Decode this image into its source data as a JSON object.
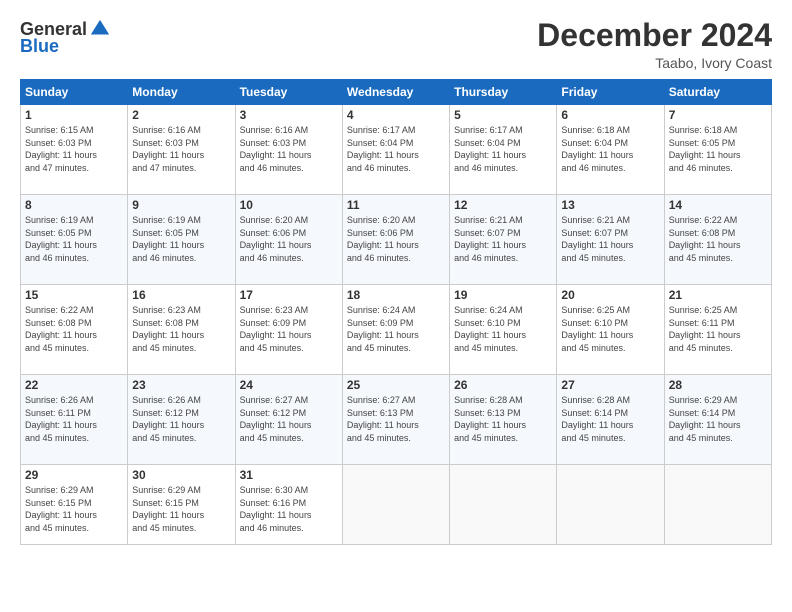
{
  "logo": {
    "general": "General",
    "blue": "Blue"
  },
  "header": {
    "title": "December 2024",
    "subtitle": "Taabo, Ivory Coast"
  },
  "weekdays": [
    "Sunday",
    "Monday",
    "Tuesday",
    "Wednesday",
    "Thursday",
    "Friday",
    "Saturday"
  ],
  "weeks": [
    [
      {
        "day": "1",
        "detail": "Sunrise: 6:15 AM\nSunset: 6:03 PM\nDaylight: 11 hours\nand 47 minutes."
      },
      {
        "day": "2",
        "detail": "Sunrise: 6:16 AM\nSunset: 6:03 PM\nDaylight: 11 hours\nand 47 minutes."
      },
      {
        "day": "3",
        "detail": "Sunrise: 6:16 AM\nSunset: 6:03 PM\nDaylight: 11 hours\nand 46 minutes."
      },
      {
        "day": "4",
        "detail": "Sunrise: 6:17 AM\nSunset: 6:04 PM\nDaylight: 11 hours\nand 46 minutes."
      },
      {
        "day": "5",
        "detail": "Sunrise: 6:17 AM\nSunset: 6:04 PM\nDaylight: 11 hours\nand 46 minutes."
      },
      {
        "day": "6",
        "detail": "Sunrise: 6:18 AM\nSunset: 6:04 PM\nDaylight: 11 hours\nand 46 minutes."
      },
      {
        "day": "7",
        "detail": "Sunrise: 6:18 AM\nSunset: 6:05 PM\nDaylight: 11 hours\nand 46 minutes."
      }
    ],
    [
      {
        "day": "8",
        "detail": "Sunrise: 6:19 AM\nSunset: 6:05 PM\nDaylight: 11 hours\nand 46 minutes."
      },
      {
        "day": "9",
        "detail": "Sunrise: 6:19 AM\nSunset: 6:05 PM\nDaylight: 11 hours\nand 46 minutes."
      },
      {
        "day": "10",
        "detail": "Sunrise: 6:20 AM\nSunset: 6:06 PM\nDaylight: 11 hours\nand 46 minutes."
      },
      {
        "day": "11",
        "detail": "Sunrise: 6:20 AM\nSunset: 6:06 PM\nDaylight: 11 hours\nand 46 minutes."
      },
      {
        "day": "12",
        "detail": "Sunrise: 6:21 AM\nSunset: 6:07 PM\nDaylight: 11 hours\nand 46 minutes."
      },
      {
        "day": "13",
        "detail": "Sunrise: 6:21 AM\nSunset: 6:07 PM\nDaylight: 11 hours\nand 45 minutes."
      },
      {
        "day": "14",
        "detail": "Sunrise: 6:22 AM\nSunset: 6:08 PM\nDaylight: 11 hours\nand 45 minutes."
      }
    ],
    [
      {
        "day": "15",
        "detail": "Sunrise: 6:22 AM\nSunset: 6:08 PM\nDaylight: 11 hours\nand 45 minutes."
      },
      {
        "day": "16",
        "detail": "Sunrise: 6:23 AM\nSunset: 6:08 PM\nDaylight: 11 hours\nand 45 minutes."
      },
      {
        "day": "17",
        "detail": "Sunrise: 6:23 AM\nSunset: 6:09 PM\nDaylight: 11 hours\nand 45 minutes."
      },
      {
        "day": "18",
        "detail": "Sunrise: 6:24 AM\nSunset: 6:09 PM\nDaylight: 11 hours\nand 45 minutes."
      },
      {
        "day": "19",
        "detail": "Sunrise: 6:24 AM\nSunset: 6:10 PM\nDaylight: 11 hours\nand 45 minutes."
      },
      {
        "day": "20",
        "detail": "Sunrise: 6:25 AM\nSunset: 6:10 PM\nDaylight: 11 hours\nand 45 minutes."
      },
      {
        "day": "21",
        "detail": "Sunrise: 6:25 AM\nSunset: 6:11 PM\nDaylight: 11 hours\nand 45 minutes."
      }
    ],
    [
      {
        "day": "22",
        "detail": "Sunrise: 6:26 AM\nSunset: 6:11 PM\nDaylight: 11 hours\nand 45 minutes."
      },
      {
        "day": "23",
        "detail": "Sunrise: 6:26 AM\nSunset: 6:12 PM\nDaylight: 11 hours\nand 45 minutes."
      },
      {
        "day": "24",
        "detail": "Sunrise: 6:27 AM\nSunset: 6:12 PM\nDaylight: 11 hours\nand 45 minutes."
      },
      {
        "day": "25",
        "detail": "Sunrise: 6:27 AM\nSunset: 6:13 PM\nDaylight: 11 hours\nand 45 minutes."
      },
      {
        "day": "26",
        "detail": "Sunrise: 6:28 AM\nSunset: 6:13 PM\nDaylight: 11 hours\nand 45 minutes."
      },
      {
        "day": "27",
        "detail": "Sunrise: 6:28 AM\nSunset: 6:14 PM\nDaylight: 11 hours\nand 45 minutes."
      },
      {
        "day": "28",
        "detail": "Sunrise: 6:29 AM\nSunset: 6:14 PM\nDaylight: 11 hours\nand 45 minutes."
      }
    ],
    [
      {
        "day": "29",
        "detail": "Sunrise: 6:29 AM\nSunset: 6:15 PM\nDaylight: 11 hours\nand 45 minutes."
      },
      {
        "day": "30",
        "detail": "Sunrise: 6:29 AM\nSunset: 6:15 PM\nDaylight: 11 hours\nand 45 minutes."
      },
      {
        "day": "31",
        "detail": "Sunrise: 6:30 AM\nSunset: 6:16 PM\nDaylight: 11 hours\nand 46 minutes."
      },
      {
        "day": "",
        "detail": ""
      },
      {
        "day": "",
        "detail": ""
      },
      {
        "day": "",
        "detail": ""
      },
      {
        "day": "",
        "detail": ""
      }
    ]
  ]
}
